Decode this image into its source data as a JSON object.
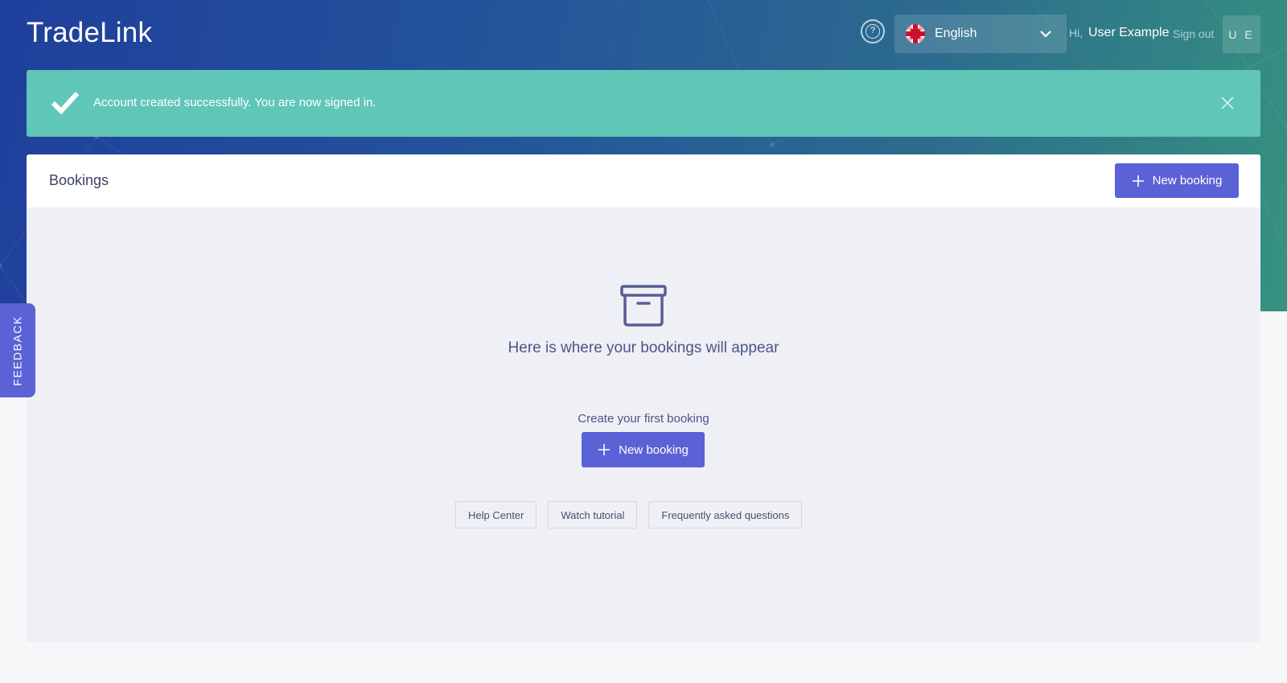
{
  "header": {
    "logo": "TradeLink",
    "help_icon_glyph": "?",
    "language": {
      "selected": "English",
      "flag_icon": "uk-flag-icon"
    },
    "greeting": "Hi,",
    "user_name": "User Example",
    "sign_out": "Sign out",
    "avatar_initials": "U E"
  },
  "alert": {
    "message": "Account created successfully. You are now signed in."
  },
  "bookings": {
    "title": "Bookings",
    "new_booking_label": "New booking",
    "empty_state": {
      "title": "Here is where your bookings will appear",
      "subtitle": "Create your first booking",
      "button_label": "New booking",
      "links": [
        "Help Center",
        "Watch tutorial",
        "Frequently asked questions"
      ]
    }
  },
  "feedback": {
    "label": "FEEDBACK"
  },
  "colors": {
    "primary": "#5b62d6",
    "success": "#60c6b8",
    "text": "#3a4163"
  }
}
